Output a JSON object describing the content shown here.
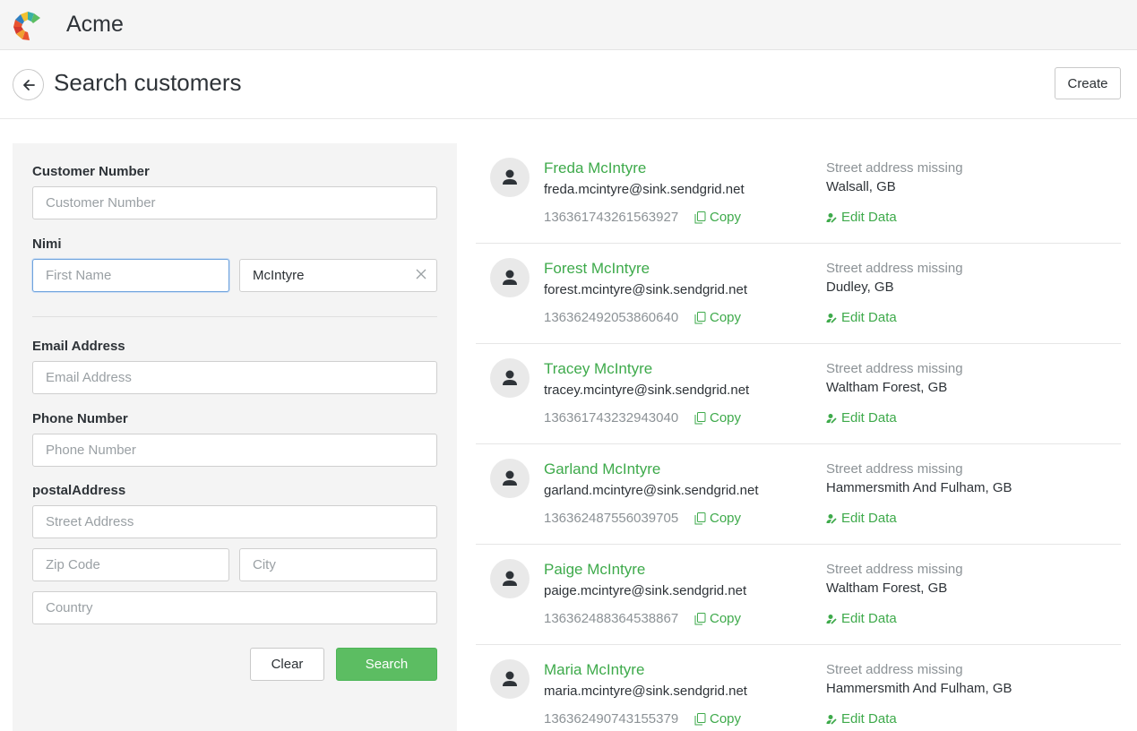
{
  "app": {
    "name": "Acme"
  },
  "header": {
    "title": "Search customers",
    "create_label": "Create"
  },
  "search": {
    "customer_number": {
      "label": "Customer Number",
      "placeholder": "Customer Number",
      "value": ""
    },
    "name": {
      "label": "Nimi",
      "first_placeholder": "First Name",
      "first_value": "",
      "last_value": "McIntyre"
    },
    "email": {
      "label": "Email Address",
      "placeholder": "Email Address",
      "value": ""
    },
    "phone": {
      "label": "Phone Number",
      "placeholder": "Phone Number",
      "value": ""
    },
    "postal": {
      "label": "postalAddress",
      "street_placeholder": "Street Address",
      "zip_placeholder": "Zip Code",
      "city_placeholder": "City",
      "country_placeholder": "Country"
    },
    "clear_label": "Clear",
    "search_label": "Search"
  },
  "results": [
    {
      "name": "Freda McIntyre",
      "email": "freda.mcintyre@sink.sendgrid.net",
      "id": "136361743261563927",
      "address_status": "Street address missing",
      "city": "Walsall, GB"
    },
    {
      "name": "Forest McIntyre",
      "email": "forest.mcintyre@sink.sendgrid.net",
      "id": "136362492053860640",
      "address_status": "Street address missing",
      "city": "Dudley, GB"
    },
    {
      "name": "Tracey McIntyre",
      "email": "tracey.mcintyre@sink.sendgrid.net",
      "id": "136361743232943040",
      "address_status": "Street address missing",
      "city": "Waltham Forest, GB"
    },
    {
      "name": "Garland McIntyre",
      "email": "garland.mcintyre@sink.sendgrid.net",
      "id": "136362487556039705",
      "address_status": "Street address missing",
      "city": "Hammersmith And Fulham, GB"
    },
    {
      "name": "Paige McIntyre",
      "email": "paige.mcintyre@sink.sendgrid.net",
      "id": "136362488364538867",
      "address_status": "Street address missing",
      "city": "Waltham Forest, GB"
    },
    {
      "name": "Maria McIntyre",
      "email": "maria.mcintyre@sink.sendgrid.net",
      "id": "136362490743155379",
      "address_status": "Street address missing",
      "city": "Hammersmith And Fulham, GB"
    }
  ],
  "row_actions": {
    "copy_label": "Copy",
    "edit_label": "Edit Data"
  },
  "colors": {
    "accent": "#3eaa4b",
    "search_button": "#5cbd62",
    "focus": "#6fa3dd"
  },
  "icons": {
    "logo": "acme-logo",
    "back": "arrow-left-icon",
    "clear": "close-icon",
    "avatar": "person-icon",
    "copy": "copy-icon",
    "edit": "edit-person-icon"
  }
}
